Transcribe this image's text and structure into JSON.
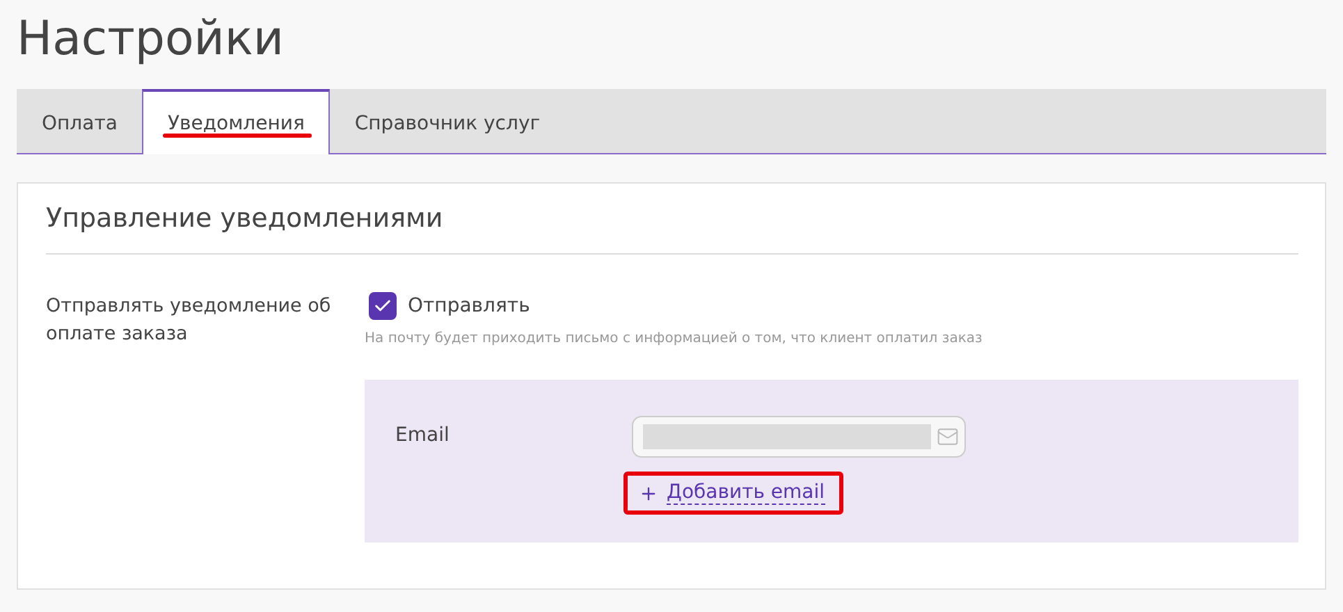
{
  "page_title": "Настройки",
  "tabs": [
    {
      "label": "Оплата",
      "selected": false,
      "highlighted": false
    },
    {
      "label": "Уведомления",
      "selected": true,
      "highlighted": true
    },
    {
      "label": "Справочник услуг",
      "selected": false,
      "highlighted": false
    }
  ],
  "section": {
    "title": "Управление уведомлениями",
    "setting": {
      "label": "Отправлять уведомление об оплате заказа",
      "checkbox": {
        "label": "Отправлять",
        "checked": true
      },
      "hint": "На почту будет приходить письмо с информацией о том, что клиент оплатил заказ"
    },
    "email_panel": {
      "label": "Email",
      "value_redacted": true,
      "add_link": {
        "label": "Добавить email",
        "highlighted": true
      }
    }
  }
}
